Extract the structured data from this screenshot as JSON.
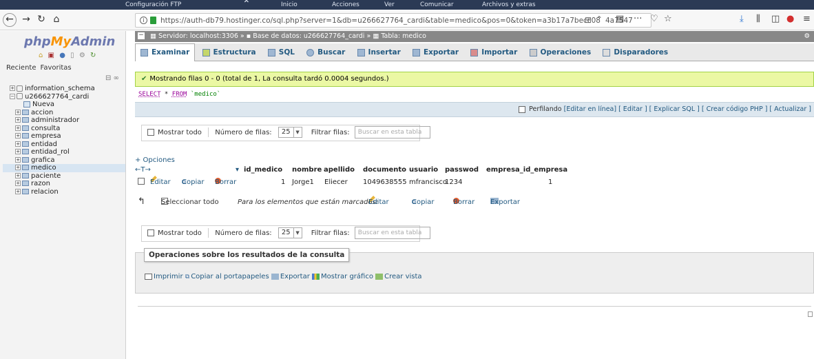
{
  "browser": {
    "tab_text_left": "",
    "tab_text_config": "Configuración FTP",
    "ext_inicio": "Inicio",
    "ext_acciones": "Acciones",
    "ext_ver": "Ver",
    "ext_comunicar": "Comunicar",
    "ext_archivos": "Archivos y extras",
    "url": "https://auth-db79.hostinger.co/sql.php?server=1&db=u266627764_cardi&table=medico&pos=0&token=a3b17a7becc08",
    "url_tail": "4a7547"
  },
  "sidebar": {
    "logo_php": "php",
    "logo_my": "My",
    "logo_admin": "Admin",
    "tab_recent": "Reciente",
    "tab_favorites": "Favoritas",
    "tree": [
      {
        "label": "information_schema",
        "level": 0,
        "kind": "db"
      },
      {
        "label": "u266627764_cardi",
        "level": 0,
        "kind": "db"
      },
      {
        "label": "Nueva",
        "level": 1,
        "kind": "new"
      },
      {
        "label": "accion",
        "level": 1,
        "kind": "table"
      },
      {
        "label": "administrador",
        "level": 1,
        "kind": "table"
      },
      {
        "label": "consulta",
        "level": 1,
        "kind": "table"
      },
      {
        "label": "empresa",
        "level": 1,
        "kind": "table"
      },
      {
        "label": "entidad",
        "level": 1,
        "kind": "table"
      },
      {
        "label": "entidad_rol",
        "level": 1,
        "kind": "table"
      },
      {
        "label": "grafica",
        "level": 1,
        "kind": "table"
      },
      {
        "label": "medico",
        "level": 1,
        "kind": "table",
        "selected": true
      },
      {
        "label": "paciente",
        "level": 1,
        "kind": "table"
      },
      {
        "label": "razon",
        "level": 1,
        "kind": "table"
      },
      {
        "label": "relacion",
        "level": 1,
        "kind": "table"
      }
    ]
  },
  "breadcrumb": {
    "server": "Servidor: localhost:3306",
    "db": "Base de datos: u266627764_cardi",
    "table": "Tabla: medico"
  },
  "tabs": [
    "Examinar",
    "Estructura",
    "SQL",
    "Buscar",
    "Insertar",
    "Exportar",
    "Importar",
    "Operaciones",
    "Disparadores"
  ],
  "success_message": "Mostrando filas 0 - 0 (total de 1, La consulta tardó 0.0004 segundos.)",
  "sql": {
    "kw1": "SELECT",
    "star": " * ",
    "kw2": "FROM",
    "table": "`medico`"
  },
  "sql_bar": {
    "profiling": "Perfilando",
    "links": "[Editar en línea] [ Editar ] [ Explicar SQL ] [ Crear código PHP ] [ Actualizar ]"
  },
  "navbox": {
    "show_all": "Mostrar todo",
    "rows_label": "Número de filas:",
    "rows_value": "25",
    "filter_label": "Filtrar filas:",
    "filter_placeholder": "Buscar en esta tabla"
  },
  "options_link": "+ Opciones",
  "table": {
    "sort_arrows": "←T→",
    "columns": [
      "id_medico",
      "nombre",
      "apellido",
      "documento",
      "usuario",
      "passwod",
      "empresa_id_empresa"
    ],
    "rows": [
      {
        "edit": "Editar",
        "copy": "Copiar",
        "delete": "Borrar",
        "cells": [
          "1",
          "Jorge1",
          "Eliecer",
          "1049638555",
          "mfrancisco",
          "1234",
          "1"
        ]
      }
    ]
  },
  "mass": {
    "select_all": "Seleccionar todo",
    "marked": "Para los elementos que están marcados:",
    "edit": "Editar",
    "copy": "Copiar",
    "delete": "Borrar",
    "export": "Exportar"
  },
  "query_ops": {
    "legend": "Operaciones sobre los resultados de la consulta",
    "print": "Imprimir",
    "copy_clip": "Copiar al portapapeles",
    "export": "Exportar",
    "chart": "Mostrar gráfico",
    "view": "Crear vista"
  },
  "colors": {
    "link": "#235a81",
    "success_bg": "#ebf8a4",
    "sidebar_bg": "#f3f3f3",
    "logo": "#6c78af",
    "logo_my": "#f89406"
  }
}
